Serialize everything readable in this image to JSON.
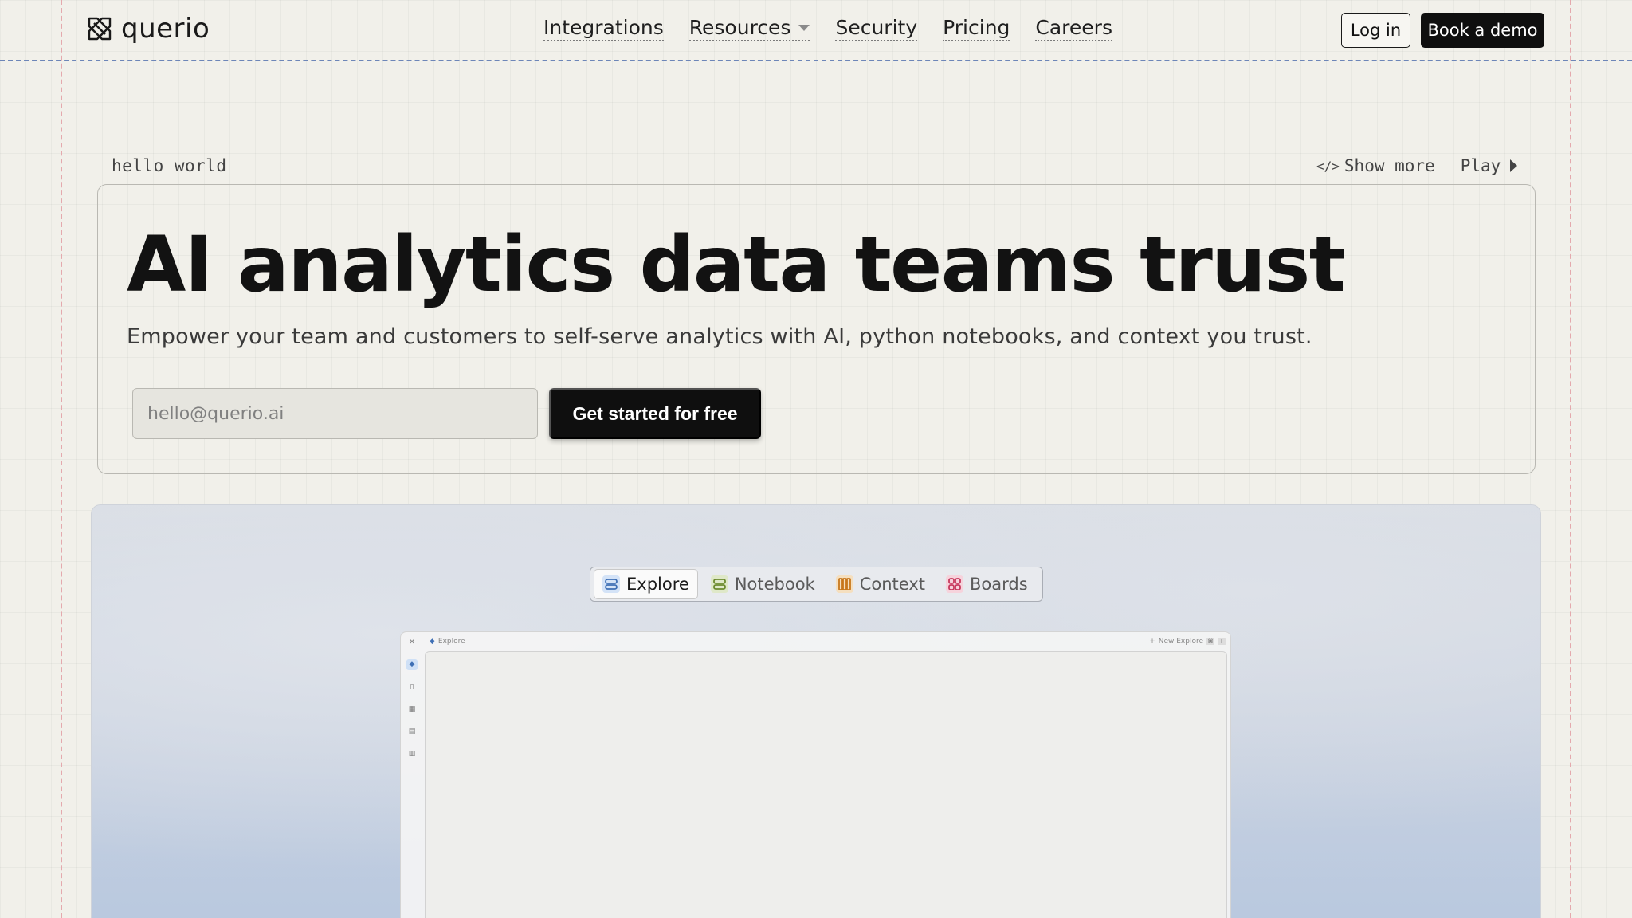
{
  "brand": {
    "name": "querio",
    "logo_icon": "querio-logo-icon"
  },
  "nav": {
    "items": [
      {
        "label": "Integrations"
      },
      {
        "label": "Resources",
        "has_dropdown": true
      },
      {
        "label": "Security"
      },
      {
        "label": "Pricing"
      },
      {
        "label": "Careers"
      }
    ],
    "login_label": "Log in",
    "demo_label": "Book a demo"
  },
  "hero": {
    "label": "hello_world",
    "show_more_label": "Show more",
    "play_label": "Play",
    "title": "AI analytics data teams trust",
    "subtitle": "Empower your team and customers to self-serve analytics with AI, python notebooks, and context you trust.",
    "email_placeholder": "hello@querio.ai",
    "cta_label": "Get started for free"
  },
  "showcase": {
    "tabs": [
      {
        "label": "Explore",
        "icon": "explore-icon",
        "color": "#3e6fb5",
        "bg": "#d4e3f7",
        "active": true
      },
      {
        "label": "Notebook",
        "icon": "notebook-icon",
        "color": "#6c8a2e",
        "bg": "#dfe8c8",
        "active": false
      },
      {
        "label": "Context",
        "icon": "context-icon",
        "color": "#c7771c",
        "bg": "#f5dfbf",
        "active": false
      },
      {
        "label": "Boards",
        "icon": "boards-icon",
        "color": "#c73a5e",
        "bg": "#f6d3dc",
        "active": false
      }
    ],
    "app": {
      "breadcrumb": "Explore",
      "new_label": "New Explore",
      "shortcut_keys": [
        "⌘",
        "I"
      ]
    }
  },
  "colors": {
    "background": "#f1f0ea",
    "primary_button": "#0f0f0f",
    "guide_red": "#e4a9ad",
    "guide_blue": "#6d86b8"
  }
}
